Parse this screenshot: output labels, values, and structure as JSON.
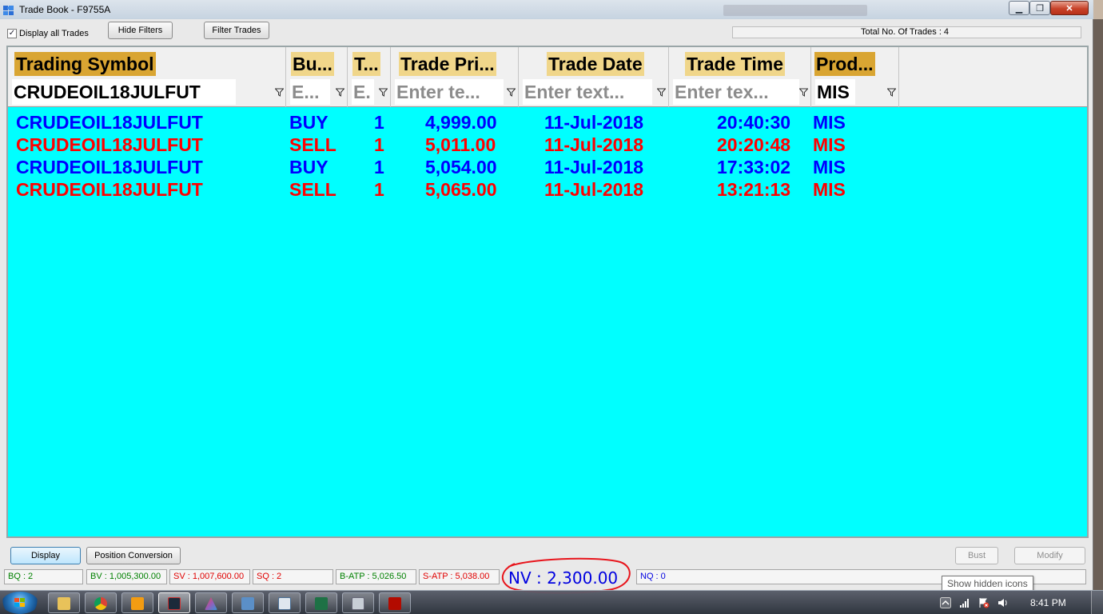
{
  "window": {
    "title": "Trade Book - F9755A",
    "minimize_icon": "minimize-icon",
    "maximize_icon": "maximize-icon",
    "close_icon": "close-icon"
  },
  "toolbar": {
    "display_all_label": "Display all Trades",
    "display_all_checked": true,
    "hide_filters_label": "Hide Filters",
    "filter_trades_label": "Filter Trades",
    "total_trades_text": "Total No. Of Trades : 4"
  },
  "grid": {
    "background": "#00ffff",
    "columns": [
      {
        "key": "symbol",
        "label": "Trading Symbol",
        "filter_value": "CRUDEOIL18JULFUT",
        "filter_placeholder": ""
      },
      {
        "key": "buysell",
        "label": "Bu...",
        "filter_value": "",
        "filter_placeholder": "E..."
      },
      {
        "key": "qty",
        "label": "T...",
        "filter_value": "",
        "filter_placeholder": "E."
      },
      {
        "key": "price",
        "label": "Trade Pri...",
        "filter_value": "",
        "filter_placeholder": "Enter te..."
      },
      {
        "key": "date",
        "label": "Trade Date",
        "filter_value": "",
        "filter_placeholder": "Enter text..."
      },
      {
        "key": "time",
        "label": "Trade Time",
        "filter_value": "",
        "filter_placeholder": "Enter tex..."
      },
      {
        "key": "product",
        "label": "Prod...",
        "filter_value": "MIS",
        "filter_placeholder": ""
      }
    ],
    "rows": [
      {
        "symbol": "CRUDEOIL18JULFUT",
        "side": "BUY",
        "qty": "1",
        "price": "4,999.00",
        "date": "11-Jul-2018",
        "time": "20:40:30",
        "product": "MIS",
        "color": "#0000ff"
      },
      {
        "symbol": "CRUDEOIL18JULFUT",
        "side": "SELL",
        "qty": "1",
        "price": "5,011.00",
        "date": "11-Jul-2018",
        "time": "20:20:48",
        "product": "MIS",
        "color": "#ff0000"
      },
      {
        "symbol": "CRUDEOIL18JULFUT",
        "side": "BUY",
        "qty": "1",
        "price": "5,054.00",
        "date": "11-Jul-2018",
        "time": "17:33:02",
        "product": "MIS",
        "color": "#0000ff"
      },
      {
        "symbol": "CRUDEOIL18JULFUT",
        "side": "SELL",
        "qty": "1",
        "price": "5,065.00",
        "date": "11-Jul-2018",
        "time": "13:21:13",
        "product": "MIS",
        "color": "#ff0000"
      }
    ]
  },
  "bottom": {
    "display_label": "Display",
    "position_conversion_label": "Position Conversion",
    "bust_label": "Bust",
    "modify_label": "Modify"
  },
  "status": {
    "bq": "BQ : 2",
    "bv": "BV : 1,005,300.00",
    "sv": "SV : 1,007,600.00",
    "sq": "SQ : 2",
    "batp": "B-ATP : 5,026.50",
    "satp": "S-ATP : 5,038.00",
    "nv": "NV : 2,300.00",
    "nq": "NQ : 0"
  },
  "taskbar": {
    "tooltip": "Show hidden icons",
    "clock": "8:41 PM",
    "pinned_icons": [
      "file-explorer-icon",
      "chrome-icon",
      "media-player-icon",
      "trading-terminal-icon",
      "triangle-app-icon",
      "network-icon",
      "window-icon",
      "excel-icon",
      "calculator-icon",
      "pdf-reader-icon"
    ]
  }
}
